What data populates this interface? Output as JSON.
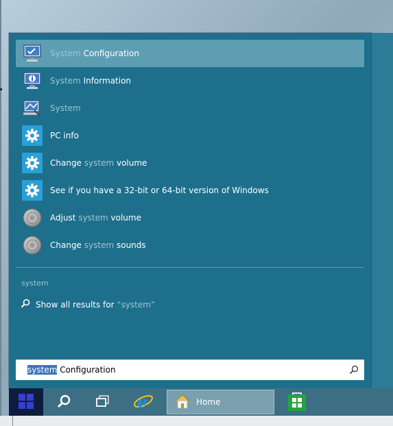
{
  "search": {
    "query": "system",
    "results": [
      {
        "icon": "system-configuration-icon",
        "prefix": "",
        "highlight": "System",
        "suffix": " Configuration",
        "selected": true
      },
      {
        "icon": "system-information-icon",
        "prefix": "",
        "highlight": "System",
        "suffix": " Information",
        "selected": false
      },
      {
        "icon": "system-icon",
        "prefix": "",
        "highlight": "System",
        "suffix": "",
        "selected": false
      },
      {
        "icon": "gear-icon",
        "prefix": "PC info",
        "highlight": "",
        "suffix": "",
        "selected": false
      },
      {
        "icon": "gear-icon",
        "prefix": "Change ",
        "highlight": "system",
        "suffix": " volume",
        "selected": false
      },
      {
        "icon": "gear-icon",
        "prefix": "See if you have a 32-bit or 64-bit version of Windows",
        "highlight": "",
        "suffix": "",
        "selected": false
      },
      {
        "icon": "speaker-icon",
        "prefix": "Adjust ",
        "highlight": "system",
        "suffix": " volume",
        "selected": false
      },
      {
        "icon": "speaker-icon",
        "prefix": "Change ",
        "highlight": "system",
        "suffix": " sounds",
        "selected": false
      }
    ],
    "query_label": "system",
    "show_all": {
      "prefix": "Show all results for ",
      "highlight": "“system”"
    },
    "box": {
      "selected_text": "system",
      "rest_text": " Configuration"
    }
  },
  "taskbar": {
    "home_label": "Home"
  },
  "colors": {
    "panel": "#1d6f8c",
    "selected_row": "#5d9eb3",
    "highlight_text": "#9fc5d4",
    "tile_blue": "#2b9fd6"
  }
}
